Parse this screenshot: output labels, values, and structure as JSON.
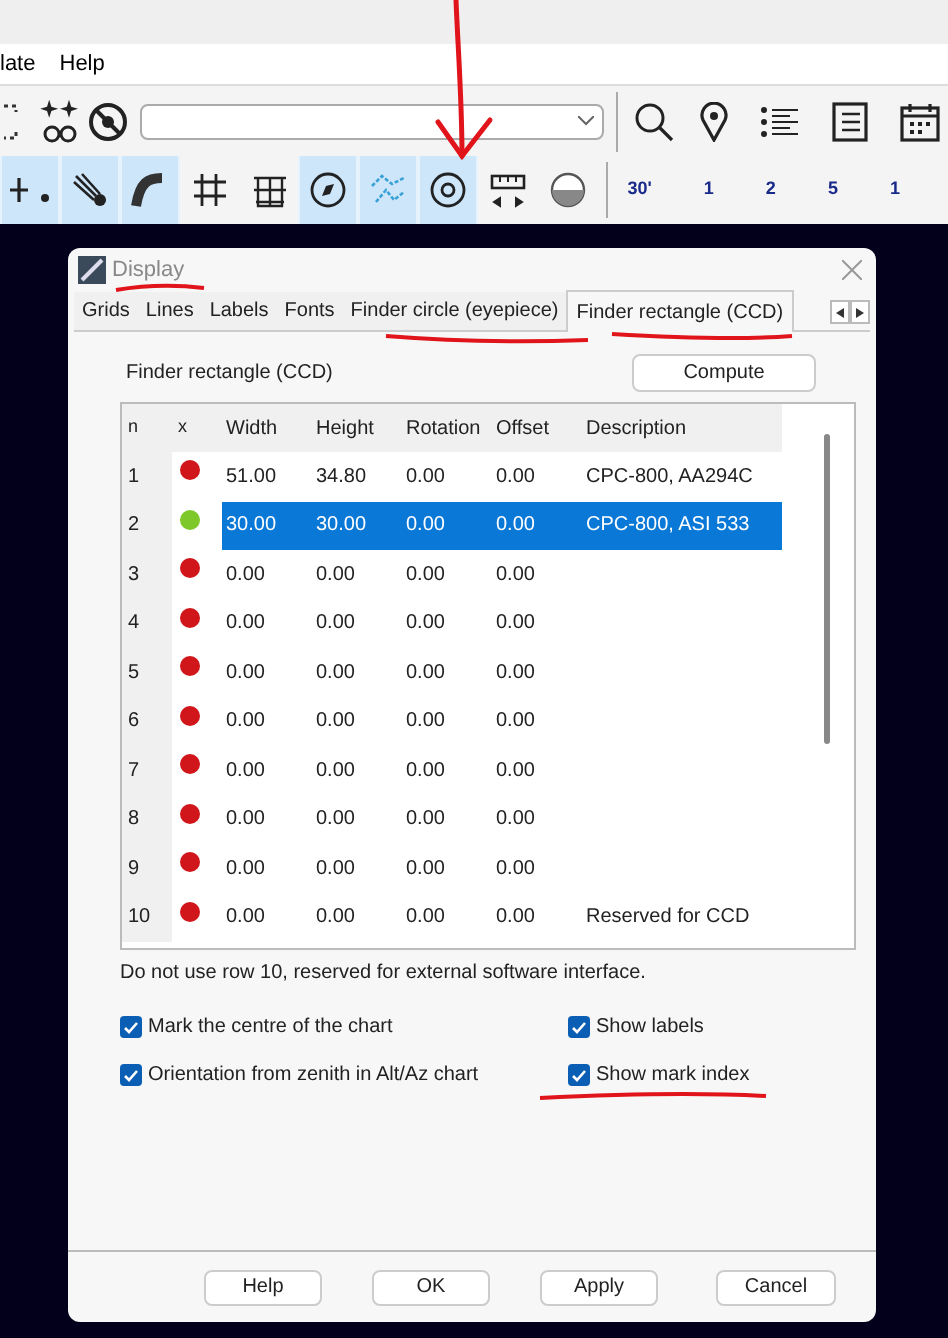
{
  "menu_bar": {
    "items": [
      "late",
      "Help"
    ]
  },
  "toolbar_bottom": {
    "tools": [
      {
        "selected": true
      },
      {
        "selected": true
      },
      {
        "selected": true
      },
      {
        "selected": false
      },
      {
        "selected": false
      },
      {
        "selected": true
      },
      {
        "selected": true
      },
      {
        "selected": true
      },
      {
        "selected": false
      },
      {
        "selected": false
      }
    ],
    "fov_buttons": [
      "30'",
      "1",
      "2",
      "5",
      "1"
    ]
  },
  "dialog": {
    "title": "Display",
    "tabs": [
      {
        "label": "Grids",
        "selected": false
      },
      {
        "label": "Lines",
        "selected": false
      },
      {
        "label": "Labels",
        "selected": false
      },
      {
        "label": "Fonts",
        "selected": false
      },
      {
        "label": "Finder circle (eyepiece)",
        "selected": false
      },
      {
        "label": "Finder rectangle (CCD)",
        "selected": true
      }
    ],
    "section_title": "Finder rectangle (CCD)",
    "compute_button": "Compute",
    "table": {
      "columns": [
        "n",
        "x",
        "Width",
        "Height",
        "Rotation",
        "Offset",
        "Description"
      ],
      "rows": [
        {
          "color": "#d0161b",
          "cells": [
            "1",
            "",
            "51.00",
            "34.80",
            "0.00",
            "0.00",
            "CPC-800, AA294C"
          ],
          "selected": false
        },
        {
          "color": "#7ec82a",
          "cells": [
            "2",
            "",
            "30.00",
            "30.00",
            "0.00",
            "0.00",
            "CPC-800, ASI 533"
          ],
          "selected": true
        },
        {
          "color": "#d0161b",
          "cells": [
            "3",
            "",
            "0.00",
            "0.00",
            "0.00",
            "0.00",
            ""
          ],
          "selected": false
        },
        {
          "color": "#d0161b",
          "cells": [
            "4",
            "",
            "0.00",
            "0.00",
            "0.00",
            "0.00",
            ""
          ],
          "selected": false
        },
        {
          "color": "#d0161b",
          "cells": [
            "5",
            "",
            "0.00",
            "0.00",
            "0.00",
            "0.00",
            ""
          ],
          "selected": false
        },
        {
          "color": "#d0161b",
          "cells": [
            "6",
            "",
            "0.00",
            "0.00",
            "0.00",
            "0.00",
            ""
          ],
          "selected": false
        },
        {
          "color": "#d0161b",
          "cells": [
            "7",
            "",
            "0.00",
            "0.00",
            "0.00",
            "0.00",
            ""
          ],
          "selected": false
        },
        {
          "color": "#d0161b",
          "cells": [
            "8",
            "",
            "0.00",
            "0.00",
            "0.00",
            "0.00",
            ""
          ],
          "selected": false
        },
        {
          "color": "#d0161b",
          "cells": [
            "9",
            "",
            "0.00",
            "0.00",
            "0.00",
            "0.00",
            ""
          ],
          "selected": false
        },
        {
          "color": "#d0161b",
          "cells": [
            "10",
            "",
            "0.00",
            "0.00",
            "0.00",
            "0.00",
            "Reserved for CCD"
          ],
          "selected": false
        }
      ]
    },
    "note": "Do not use row 10, reserved for external software interface.",
    "options": [
      {
        "label": "Mark the centre of the chart",
        "checked": true
      },
      {
        "label": "Show labels",
        "checked": true
      },
      {
        "label": "Orientation from zenith in Alt/Az chart",
        "checked": true
      },
      {
        "label": "Show mark index",
        "checked": true
      }
    ],
    "buttons": [
      "Help",
      "OK",
      "Apply",
      "Cancel"
    ]
  }
}
